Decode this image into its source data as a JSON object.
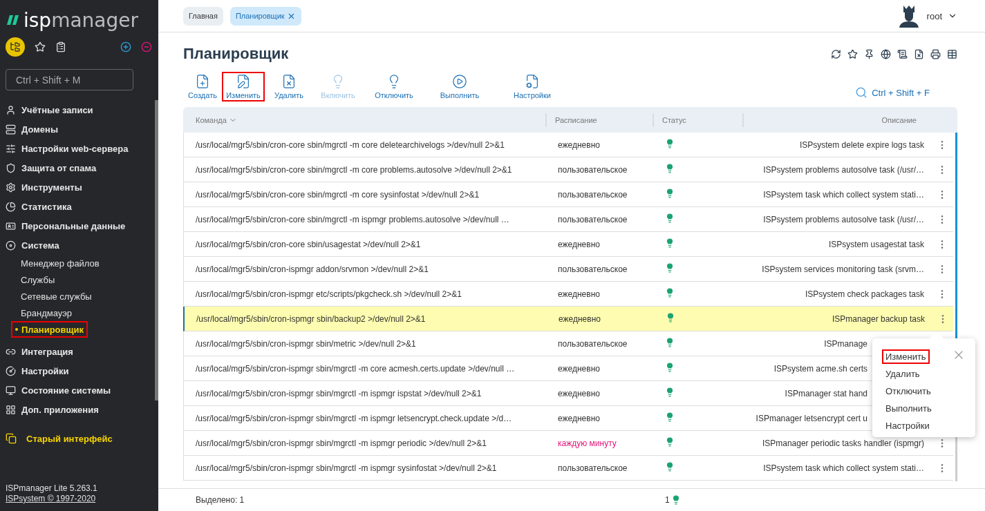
{
  "sidebar": {
    "logo": {
      "left": "isp",
      "right": "manager"
    },
    "search": {
      "placeholder": "Ctrl + Shift + M"
    },
    "items": [
      {
        "label": "Учётные записи",
        "selected": false
      },
      {
        "label": "Домены",
        "selected": false
      },
      {
        "label": "Настройки web-сервера",
        "selected": false
      },
      {
        "label": "Защита от спама",
        "selected": false
      },
      {
        "label": "Инструменты",
        "selected": false
      },
      {
        "label": "Статистика",
        "selected": false
      },
      {
        "label": "Персональные данные",
        "selected": false
      },
      {
        "label": "Система",
        "selected": false,
        "children": [
          {
            "label": "Менеджер файлов",
            "selected": false,
            "highlighted": false
          },
          {
            "label": "Службы",
            "selected": false,
            "highlighted": false
          },
          {
            "label": "Сетевые службы",
            "selected": false,
            "highlighted": false
          },
          {
            "label": "Брандмауэр",
            "selected": false,
            "highlighted": false
          },
          {
            "label": "Планировщик",
            "selected": true,
            "highlighted": true
          }
        ]
      },
      {
        "label": "Интеграция",
        "selected": false
      },
      {
        "label": "Настройки",
        "selected": false
      },
      {
        "label": "Состояние системы",
        "selected": false
      },
      {
        "label": "Доп. приложения",
        "selected": false
      }
    ],
    "old_interface": "Старый интерфейс",
    "version": "ISPmanager Lite 5.263.1",
    "copyright": "ISPsystem © 1997-2020"
  },
  "tabs": [
    {
      "label": "Главная",
      "selected": false
    },
    {
      "label": "Планировщик",
      "selected": true
    }
  ],
  "user": {
    "name": "root"
  },
  "page_title": "Планировщик",
  "toolbar": [
    {
      "label": "Создать",
      "disabled": false,
      "highlighted": false
    },
    {
      "label": "Изменить",
      "disabled": false,
      "highlighted": true
    },
    {
      "label": "Удалить",
      "disabled": false,
      "highlighted": false
    },
    {
      "label": "Включить",
      "disabled": true,
      "highlighted": false
    },
    {
      "label": "Отключить",
      "disabled": false,
      "highlighted": false
    },
    {
      "label": "Выполнить",
      "disabled": false,
      "highlighted": false
    },
    {
      "label": "Настройки",
      "disabled": false,
      "highlighted": false
    }
  ],
  "table_search": {
    "placeholder": "Ctrl + Shift + F"
  },
  "table": {
    "columns": [
      "Команда",
      "Расписание",
      "Статус",
      "Описание"
    ],
    "rows": [
      {
        "command": "/usr/local/mgr5/sbin/cron-core sbin/mgrctl -m core deletearchivelogs >/dev/null 2>&1",
        "schedule": "ежедневно",
        "frequent": false,
        "description": "ISPsystem delete expire logs task",
        "selected": false
      },
      {
        "command": "/usr/local/mgr5/sbin/cron-core sbin/mgrctl -m core problems.autosolve >/dev/null 2>&1",
        "schedule": "пользовательское",
        "frequent": false,
        "description": "ISPsystem problems autosolve task (/usr/…",
        "selected": false
      },
      {
        "command": "/usr/local/mgr5/sbin/cron-core sbin/mgrctl -m core sysinfostat >/dev/null 2>&1",
        "schedule": "пользовательское",
        "frequent": false,
        "description": "ISPsystem task which collect system stati…",
        "selected": false
      },
      {
        "command": "/usr/local/mgr5/sbin/cron-core sbin/mgrctl -m ispmgr problems.autosolve >/dev/null …",
        "schedule": "пользовательское",
        "frequent": false,
        "description": "ISPsystem problems autosolve task (/usr/…",
        "selected": false
      },
      {
        "command": "/usr/local/mgr5/sbin/cron-core sbin/usagestat >/dev/null 2>&1",
        "schedule": "ежедневно",
        "frequent": false,
        "description": "ISPsystem usagestat task",
        "selected": false
      },
      {
        "command": "/usr/local/mgr5/sbin/cron-ispmgr addon/srvmon >/dev/null 2>&1",
        "schedule": "пользовательское",
        "frequent": false,
        "description": "ISPsystem services monitoring task (srvm…",
        "selected": false
      },
      {
        "command": "/usr/local/mgr5/sbin/cron-ispmgr etc/scripts/pkgcheck.sh >/dev/null 2>&1",
        "schedule": "ежедневно",
        "frequent": false,
        "description": "ISPsystem check packages task",
        "selected": false
      },
      {
        "command": "/usr/local/mgr5/sbin/cron-ispmgr sbin/backup2 >/dev/null 2>&1",
        "schedule": "ежедневно",
        "frequent": false,
        "description": "ISPmanager backup task",
        "selected": true
      },
      {
        "command": "/usr/local/mgr5/sbin/cron-ispmgr sbin/metric >/dev/null 2>&1",
        "schedule": "пользовательское",
        "frequent": false,
        "description": "ISPmanage",
        "selected": false
      },
      {
        "command": "/usr/local/mgr5/sbin/cron-ispmgr sbin/mgrctl -m core acmesh.certs.update >/dev/null …",
        "schedule": "ежедневно",
        "frequent": false,
        "description": "ISPsystem acme.sh certs",
        "selected": false
      },
      {
        "command": "/usr/local/mgr5/sbin/cron-ispmgr sbin/mgrctl -m ispmgr ispstat >/dev/null 2>&1",
        "schedule": "ежедневно",
        "frequent": false,
        "description": "ISPmanager stat hand",
        "selected": false
      },
      {
        "command": "/usr/local/mgr5/sbin/cron-ispmgr sbin/mgrctl -m ispmgr letsencrypt.check.update >/d…",
        "schedule": "ежедневно",
        "frequent": false,
        "description": "ISPmanager letsencrypt cert u",
        "selected": false
      },
      {
        "command": "/usr/local/mgr5/sbin/cron-ispmgr sbin/mgrctl -m ispmgr periodic >/dev/null 2>&1",
        "schedule": "каждую минуту",
        "frequent": true,
        "description": "ISPmanager periodic tasks handler (ispmgr)",
        "selected": false
      },
      {
        "command": "/usr/local/mgr5/sbin/cron-ispmgr sbin/mgrctl -m ispmgr sysinfostat >/dev/null 2>&1",
        "schedule": "пользовательское",
        "frequent": false,
        "description": "ISPsystem task which collect system stati…",
        "selected": false
      }
    ]
  },
  "context_menu": {
    "items": [
      {
        "label": "Изменить",
        "highlighted": true
      },
      {
        "label": "Удалить",
        "highlighted": false
      },
      {
        "label": "Отключить",
        "highlighted": false
      },
      {
        "label": "Выполнить",
        "highlighted": false
      },
      {
        "label": "Настройки",
        "highlighted": false
      }
    ]
  },
  "footer": {
    "selected_text": "Выделено: 1",
    "count": "1"
  }
}
